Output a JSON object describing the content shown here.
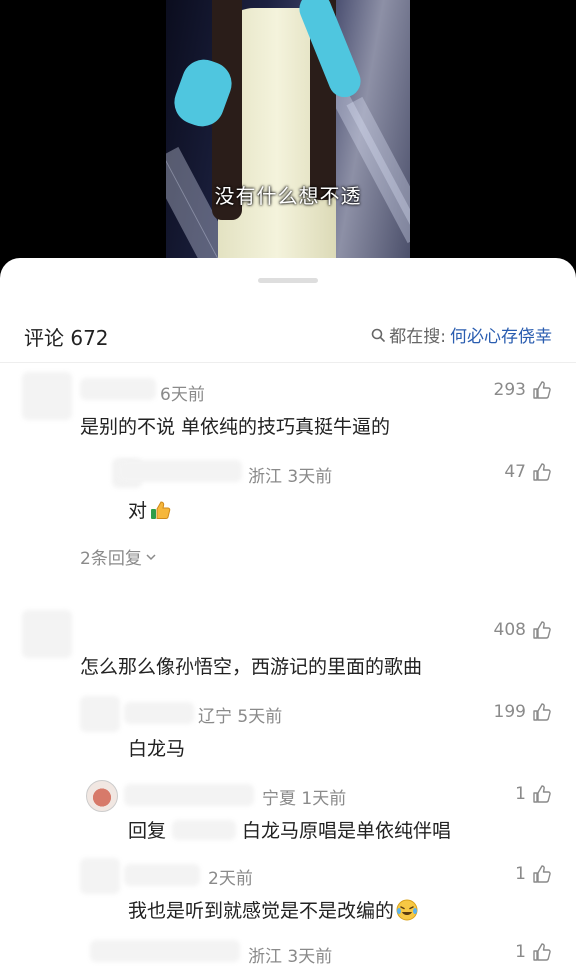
{
  "video": {
    "subtitle": "没有什么想不透"
  },
  "comments_panel": {
    "title": "评论 672",
    "search_prefix": "都在搜:",
    "search_keyword": "何必心存侥幸"
  },
  "comments": [
    {
      "meta": "6天前",
      "text": "是别的不说 单依纯的技巧真挺牛逼的",
      "likes": "293"
    },
    {
      "meta": "浙江 3天前",
      "text": "对",
      "likes": "47",
      "emoji": "thumbs-up"
    },
    {
      "expand": "2条回复"
    },
    {
      "meta": "",
      "text": "怎么那么像孙悟空，西游记的里面的歌曲",
      "likes": "408"
    },
    {
      "meta": "辽宁 5天前",
      "text": "白龙马",
      "likes": "199"
    },
    {
      "meta": "宁夏 1天前",
      "text_prefix": "回复",
      "text": "白龙马原唱是单依纯伴唱",
      "likes": "1"
    },
    {
      "meta": "2天前",
      "text": "我也是听到就感觉是不是改编的",
      "likes": "1",
      "emoji": "laughing-crying"
    },
    {
      "meta": "浙江 3天前",
      "likes": "1"
    }
  ],
  "colors": {
    "accent": "#2a5db0",
    "secondary_text": "#8a8a8a",
    "background": "#ffffff"
  }
}
